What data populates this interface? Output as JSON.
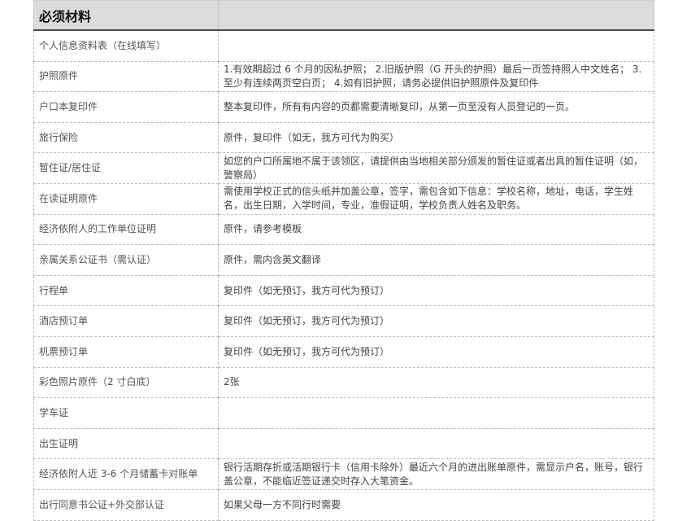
{
  "table": {
    "header_title": "必须材料",
    "header_col2": "",
    "rows": [
      {
        "name": "个人信息资料表（在线填写）",
        "desc": ""
      },
      {
        "name": "护照原件",
        "desc": "1.有效期超过 6 个月的因私护照； 2.旧版护照（G 开头的护照）最后一页签持照人中文姓名； 3.至少有连续两页空白页； 4.如有旧护照，请务必提供旧护照原件及复印件"
      },
      {
        "name": "户口本复印件",
        "desc": "整本复印件，所有有内容的页都需要清晰复印，从第一页至没有人员登记的一页。"
      },
      {
        "name": "旅行保险",
        "desc": "原件，复印件（如无，我方可代为购买）"
      },
      {
        "name": "暂住证/居住证",
        "desc": "如您的户口所属地不属于该领区，请提供由当地相关部分颁发的暂住证或者出具的暂住证明（如，警察局）"
      },
      {
        "name": "在读证明原件",
        "desc": "需使用学校正式的信头纸并加盖公章，签字，需包含如下信息：学校名称，地址，电话，学生姓名，出生日期，入学时间，专业，准假证明，学校负责人姓名及职务。"
      },
      {
        "name": "经济依附人的工作单位证明",
        "desc": "原件，请参考模板"
      },
      {
        "name": "亲属关系公证书（需认证）",
        "desc": "原件，需内含英文翻译"
      },
      {
        "name": "行程单",
        "desc": "复印件（如无预订，我方可代为预订）"
      },
      {
        "name": "酒店预订单",
        "desc": "复印件（如无预订，我方可代为预订）"
      },
      {
        "name": "机票预订单",
        "desc": "复印件（如无预订，我方可代为预订）"
      },
      {
        "name": "彩色照片原件（2 寸白底）",
        "desc": "2张"
      },
      {
        "name": "学车证",
        "desc": ""
      },
      {
        "name": "出生证明",
        "desc": ""
      },
      {
        "name": "经济依附人近 3-6 个月储蓄卡对账单",
        "desc": "银行活期存折或活期银行卡（信用卡除外）最近六个月的进出账单原件，需显示户名，账号，银行盖公章，不能临近签证递交时存入大笔资金。"
      },
      {
        "name": "出行同意书公证+外交部认证",
        "desc": "如果父母一方不同行时需要"
      }
    ]
  }
}
